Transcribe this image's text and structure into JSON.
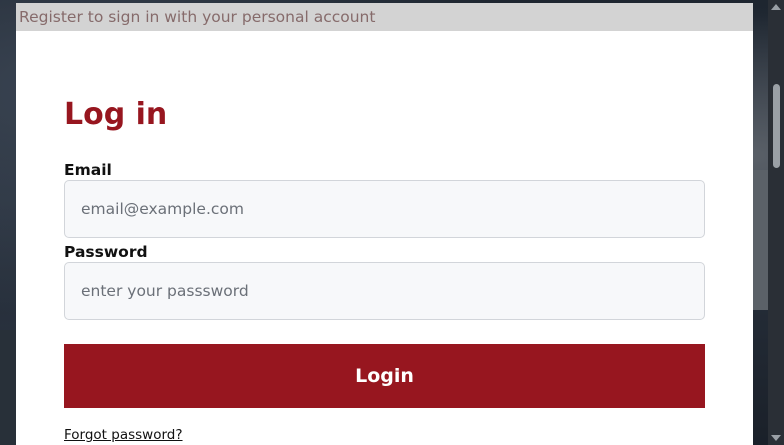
{
  "modal": {
    "header_text": "Register to sign in with your personal account",
    "title": "Log in"
  },
  "form": {
    "email_label": "Email",
    "email_placeholder": "email@example.com",
    "password_label": "Password",
    "password_placeholder": "enter your passsword",
    "login_button": "Login",
    "forgot_link": "Forgot password?"
  },
  "colors": {
    "accent": "#97161f",
    "header_bg": "#d3d3d3",
    "header_text": "#866b6b"
  }
}
